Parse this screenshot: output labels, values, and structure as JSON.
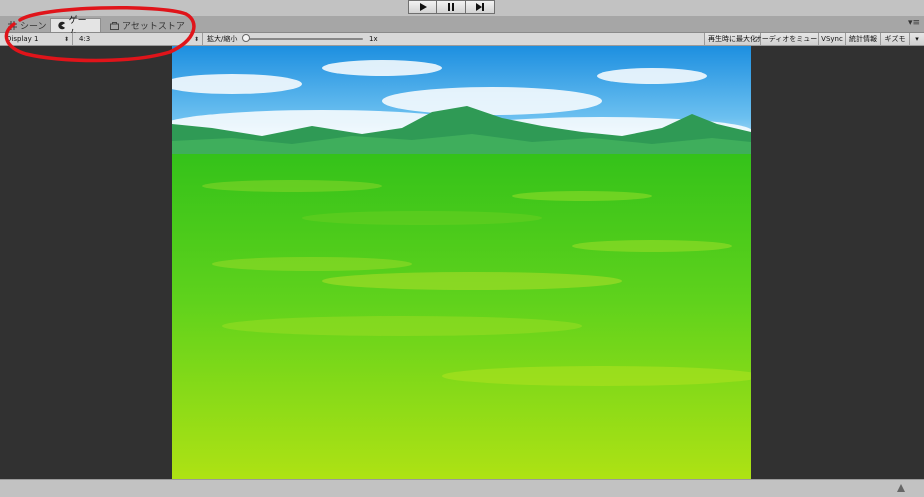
{
  "play_controls": {
    "play_icon": "play-icon",
    "pause_icon": "pause-icon",
    "step_icon": "step-icon"
  },
  "tabs": [
    {
      "label": "シーン",
      "icon": "grid-icon"
    },
    {
      "label": "ゲーム",
      "icon": "pacman-icon",
      "active": true
    },
    {
      "label": "アセットストア",
      "icon": "bag-icon"
    }
  ],
  "tab_menu_icon": "menu-icon",
  "toolbar": {
    "display_value": "Display 1",
    "aspect_value": "4:3",
    "scale_label": "拡大/縮小",
    "scale_value": "1x",
    "maximize_on_play": "再生時に最大化",
    "mute_audio": "オーディオをミュート",
    "vsync": "VSync",
    "stats": "統計情報",
    "gizmos": "ギズモ"
  },
  "colors": {
    "sky_top": "#1d8fe0",
    "grass_bottom": "#aee214",
    "annotation": "#e0141a"
  },
  "status_icon": "warning-icon"
}
